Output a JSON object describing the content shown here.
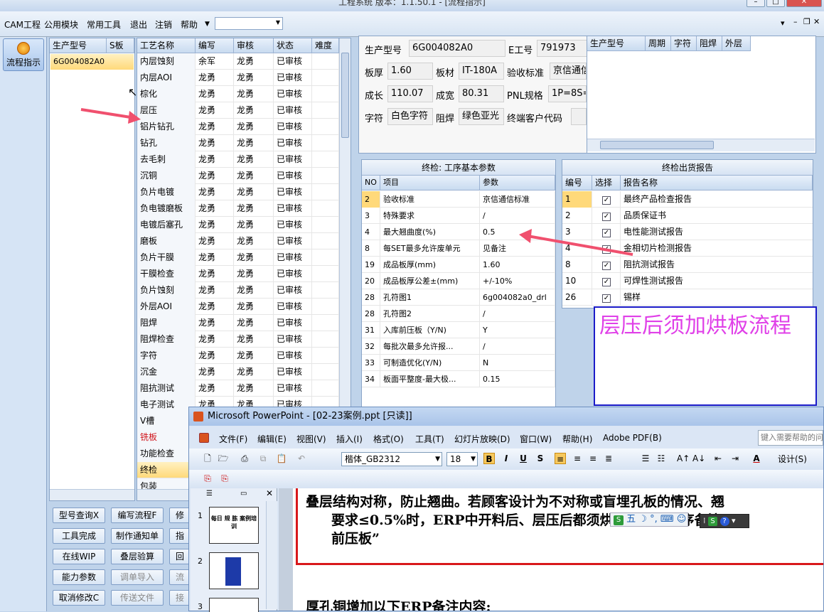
{
  "app": {
    "title": "工程系统   版本：1.1.50.1 - [流程指示]"
  },
  "menu": {
    "items": [
      "CAM工程",
      "公用模块",
      "常用工具",
      "退出",
      "注销",
      "帮助"
    ]
  },
  "left": {
    "flow_button": "流程指示"
  },
  "model_list": {
    "col1": "生产型号",
    "col2": "S板",
    "items": [
      "6G004082A0"
    ]
  },
  "process": {
    "headers": [
      "工艺名称",
      "编写",
      "审核",
      "状态",
      "难度"
    ],
    "rows": [
      [
        "内层蚀刻",
        "余军",
        "龙勇",
        "已审核"
      ],
      [
        "内层AOI",
        "龙勇",
        "龙勇",
        "已审核"
      ],
      [
        "棕化",
        "龙勇",
        "龙勇",
        "已审核"
      ],
      [
        "层压",
        "龙勇",
        "龙勇",
        "已审核"
      ],
      [
        "铝片钻孔",
        "龙勇",
        "龙勇",
        "已审核"
      ],
      [
        "钻孔",
        "龙勇",
        "龙勇",
        "已审核"
      ],
      [
        "去毛刺",
        "龙勇",
        "龙勇",
        "已审核"
      ],
      [
        "沉铜",
        "龙勇",
        "龙勇",
        "已审核"
      ],
      [
        "负片电镀",
        "龙勇",
        "龙勇",
        "已审核"
      ],
      [
        "负电镀磨板",
        "龙勇",
        "龙勇",
        "已审核"
      ],
      [
        "电镀后塞孔",
        "龙勇",
        "龙勇",
        "已审核"
      ],
      [
        "磨板",
        "龙勇",
        "龙勇",
        "已审核"
      ],
      [
        "负片干膜",
        "龙勇",
        "龙勇",
        "已审核"
      ],
      [
        "干膜检查",
        "龙勇",
        "龙勇",
        "已审核"
      ],
      [
        "负片蚀刻",
        "龙勇",
        "龙勇",
        "已审核"
      ],
      [
        "外层AOI",
        "龙勇",
        "龙勇",
        "已审核"
      ],
      [
        "阻焊",
        "龙勇",
        "龙勇",
        "已审核"
      ],
      [
        "阻焊检查",
        "龙勇",
        "龙勇",
        "已审核"
      ],
      [
        "字符",
        "龙勇",
        "龙勇",
        "已审核"
      ],
      [
        "沉金",
        "龙勇",
        "龙勇",
        "已审核"
      ],
      [
        "阻抗测试",
        "龙勇",
        "龙勇",
        "已审核"
      ],
      [
        "电子测试",
        "龙勇",
        "龙勇",
        "已审核"
      ],
      [
        "V槽",
        "",
        "",
        ""
      ],
      [
        "铣板",
        "",
        "",
        ""
      ],
      [
        "功能检查",
        "",
        "",
        ""
      ],
      [
        "终检",
        "",
        "",
        ""
      ],
      [
        "包装",
        "",
        "",
        ""
      ]
    ]
  },
  "info": {
    "model_label": "生产型号",
    "model_value": "6G004082A0",
    "e_label": "E工号",
    "e_value": "791973",
    "thick_label": "板厚",
    "thick_value": "1.60",
    "material_label": "板材",
    "material_value": "IT-180A",
    "std_label": "验收标准",
    "std_value": "京信通信",
    "len_label": "成长",
    "len_value": "110.07",
    "wid_label": "成宽",
    "wid_value": "80.31",
    "pnl_label": "PNL规格",
    "pnl_value": "1P=8S=",
    "char_label": "字符",
    "char_value": "白色字符",
    "mask_label": "阻焊",
    "mask_value": "绿色亚光",
    "cust_label": "终端客户代码",
    "mini_headers": [
      "生产型号",
      "周期",
      "字符",
      "阻焊",
      "外层"
    ]
  },
  "params": {
    "title": "终检: 工序基本参数",
    "headers": [
      "NO",
      "项目",
      "参数"
    ],
    "rows": [
      [
        "2",
        "验收标准",
        "京信通信标准"
      ],
      [
        "3",
        "特殊要求",
        "/"
      ],
      [
        "4",
        "最大翘曲度(%)",
        "0.5"
      ],
      [
        "8",
        "每SET最多允许废单元",
        "见备注"
      ],
      [
        "19",
        "成品板厚(mm)",
        "1.60"
      ],
      [
        "20",
        "成品板厚公差±(mm)",
        "+/-10%"
      ],
      [
        "28",
        "孔符图1",
        "6g004082a0_drl"
      ],
      [
        "28",
        "孔符图2",
        "/"
      ],
      [
        "31",
        "入库前压板（Y/N)",
        "Y"
      ],
      [
        "32",
        "每批次最多允许报...",
        "/"
      ],
      [
        "33",
        "可制造优化(Y/N)",
        "N"
      ],
      [
        "34",
        "板面平整度-最大极...",
        "0.15"
      ]
    ]
  },
  "reports": {
    "title": "终检出货报告",
    "headers": [
      "编号",
      "选择",
      "报告名称"
    ],
    "rows": [
      [
        "1",
        "最终产品检查报告"
      ],
      [
        "2",
        "品质保证书"
      ],
      [
        "3",
        "电性能测试报告"
      ],
      [
        "4",
        "金相切片检测报告"
      ],
      [
        "8",
        "阻抗测试报告"
      ],
      [
        "10",
        "可焊性测试报告"
      ],
      [
        "26",
        "锡样"
      ]
    ]
  },
  "note_box": {
    "text": "层压后须加烘板流程"
  },
  "buttons": {
    "row1": [
      "型号查询X",
      "编写流程F",
      "修"
    ],
    "row2": [
      "工具完成",
      "制作通知单",
      "指"
    ],
    "row3": [
      "在线WIP",
      "叠层验算",
      "回"
    ],
    "row4": [
      "能力参数",
      "调单导入",
      "流"
    ],
    "row5": [
      "取消修改C",
      "传送文件",
      "接"
    ]
  },
  "ppt": {
    "title": "Microsoft PowerPoint - [02-23案例.ppt [只读]]",
    "menu": [
      "文件(F)",
      "编辑(E)",
      "视图(V)",
      "插入(I)",
      "格式(O)",
      "工具(T)",
      "幻灯片放映(D)",
      "窗口(W)",
      "帮助(H)",
      "Adobe PDF(B)"
    ],
    "help_placeholder": "键入需要帮助的问",
    "font": "楷体_GB2312",
    "size": "18",
    "design": "设计(S)",
    "slides": [
      "1",
      "2",
      "3"
    ],
    "slide1_text": "每日 规 胨 案例培训",
    "body_line1": "叠层结构对称，防止翘曲。若顾客设计为不对称或盲埋孔板的情况、翘",
    "body_line2": "要求≤0.5%时，ERP中开料后、层压后都须烘板，终检工序备注“",
    "body_line3": "前压板”",
    "body_line4": "厚孔铜增加以下ERP备注内容:",
    "ime": "五"
  }
}
